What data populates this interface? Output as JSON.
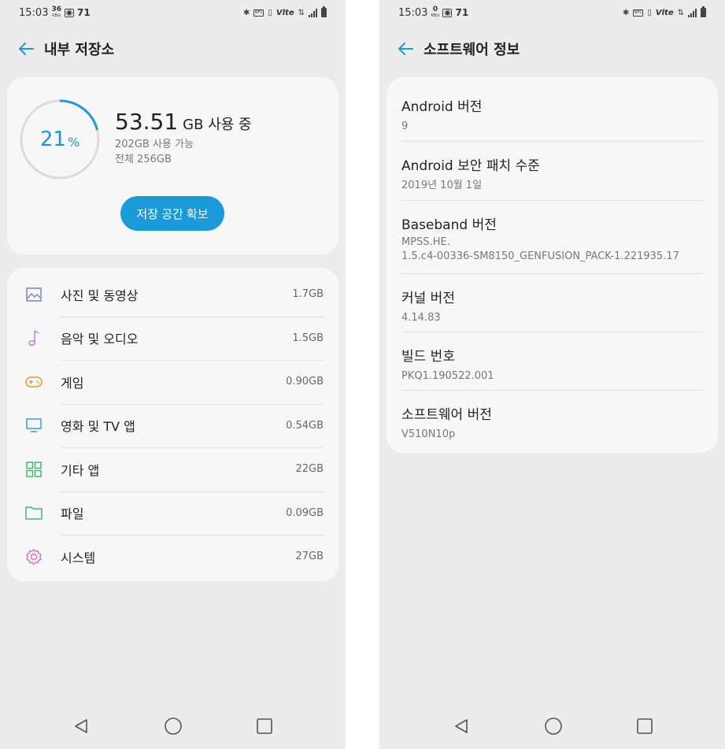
{
  "colors": {
    "accent": "#1a9ad9",
    "screen_bg": "#ececec",
    "card_bg": "#f7f7f7"
  },
  "left": {
    "status": {
      "time": "15:03",
      "speed_num": "36",
      "speed_unit": "KB/s",
      "battery": "71"
    },
    "title": "내부 저장소",
    "summary": {
      "percent": "21",
      "percent_sign": "%",
      "percent_value": 0.21,
      "used_num": "53.51",
      "used_unit": "GB 사용 중",
      "available": "202GB 사용 가능",
      "total": "전체 256GB",
      "free_button": "저장 공간 확보"
    },
    "categories": [
      {
        "label": "사진 및 동영상",
        "size": "1.7GB",
        "icon": "image-icon",
        "color": "#7a7fd8"
      },
      {
        "label": "음악 및 오디오",
        "size": "1.5GB",
        "icon": "music-note-icon",
        "color": "#c07fd8"
      },
      {
        "label": "게임",
        "size": "0.90GB",
        "icon": "gamepad-icon",
        "color": "#e59a2a"
      },
      {
        "label": "영화 및 TV 앱",
        "size": "0.54GB",
        "icon": "tv-icon",
        "color": "#2aa5d9"
      },
      {
        "label": "기타 앱",
        "size": "22GB",
        "icon": "apps-grid-icon",
        "color": "#3dbd6a"
      },
      {
        "label": "파일",
        "size": "0.09GB",
        "icon": "folder-icon",
        "color": "#3dbd6a"
      },
      {
        "label": "시스템",
        "size": "27GB",
        "icon": "gear-icon",
        "color": "#d86fc6"
      }
    ]
  },
  "right": {
    "status": {
      "time": "15:03",
      "speed_num": "0",
      "speed_unit": "KB/s",
      "battery": "71"
    },
    "title": "소프트웨어 정보",
    "items": [
      {
        "title": "Android 버전",
        "value": "9"
      },
      {
        "title": "Android 보안 패치 수준",
        "value": "2019년 10월 1일"
      },
      {
        "title": "Baseband 버전",
        "value": "MPSS.HE.",
        "value2": "1.5.c4-00336-SM8150_GENFUSION_PACK-1.221935.17"
      },
      {
        "title": "커널 버전",
        "value": "4.14.83"
      },
      {
        "title": "빌드 번호",
        "value": "PKQ1.190522.001"
      },
      {
        "title": "소프트웨어 버전",
        "value": "V510N10p"
      }
    ]
  }
}
